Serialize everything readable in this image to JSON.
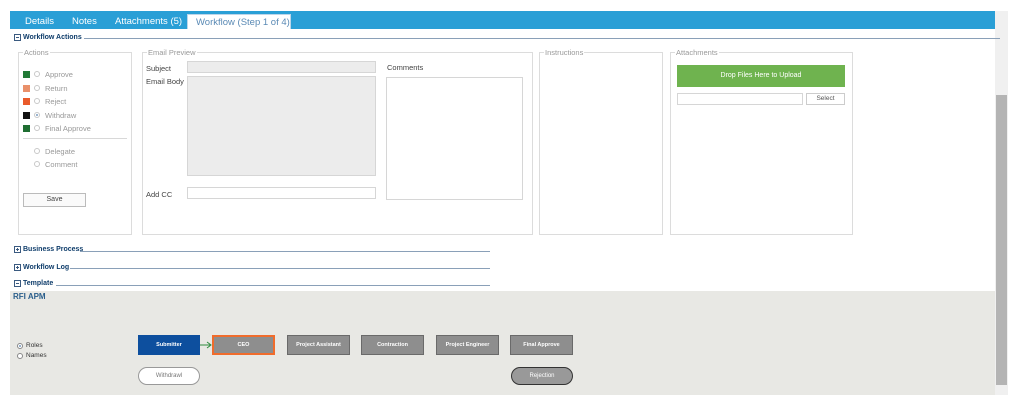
{
  "tabs": [
    {
      "label": "Details",
      "active": false
    },
    {
      "label": "Notes",
      "active": false
    },
    {
      "label": "Attachments (5)",
      "active": false
    },
    {
      "label": "Workflow (Step 1 of 4)",
      "active": true
    }
  ],
  "sections": {
    "workflow_actions": "Workflow Actions",
    "business_process": "Business Process",
    "workflow_log": "Workflow Log",
    "template": "Template"
  },
  "actions": {
    "legend": "Actions",
    "items": [
      {
        "label": "Approve",
        "color": "#217a36",
        "selected": false
      },
      {
        "label": "Return",
        "color": "#e9906a",
        "selected": false
      },
      {
        "label": "Reject",
        "color": "#e95a2a",
        "selected": false
      },
      {
        "label": "Withdraw",
        "color": "#111111",
        "selected": true
      },
      {
        "label": "Final Approve",
        "color": "#1f6e32",
        "selected": false
      }
    ],
    "secondary": [
      {
        "label": "Delegate"
      },
      {
        "label": "Comment"
      }
    ],
    "save_label": "Save"
  },
  "email_preview": {
    "legend": "Email Preview",
    "subject_label": "Subject",
    "body_label": "Email Body",
    "cc_label": "Add CC",
    "comments_label": "Comments"
  },
  "instructions": {
    "legend": "Instructions"
  },
  "attachments": {
    "legend": "Attachments",
    "drop_label": "Drop Files Here to Upload",
    "select_label": "Select"
  },
  "template": {
    "title": "RFI APM",
    "view_options": [
      {
        "label": "Roles",
        "selected": true
      },
      {
        "label": "Names",
        "selected": false
      }
    ],
    "steps": [
      {
        "label": "Submitter",
        "color": "#0d4f9e",
        "text_color": "#ffffff"
      },
      {
        "label": "CEO",
        "color": "#8e8e8e",
        "text_color": "#ffffff",
        "highlight": "#f06c2c"
      },
      {
        "label": "Project Assistant",
        "color": "#8e8e8e",
        "text_color": "#ffffff"
      },
      {
        "label": "Contraction",
        "color": "#8e8e8e",
        "text_color": "#ffffff"
      },
      {
        "label": "Project Engineer",
        "color": "#8e8e8e",
        "text_color": "#ffffff"
      },
      {
        "label": "Final Approve",
        "color": "#8e8e8e",
        "text_color": "#ffffff"
      }
    ],
    "arrow_color": "#2e8b3e",
    "withdrawal_label": "Withdrawl",
    "rejection_label": "Rejection"
  },
  "colors": {
    "tab_bar": "#2a9fd6",
    "drop_zone": "#6fb34f",
    "section_text": "#0f3d6b"
  }
}
